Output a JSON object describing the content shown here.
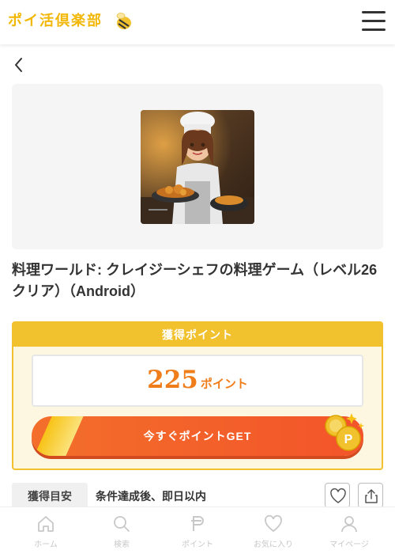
{
  "header": {
    "logo_text": "ポイ活倶楽部",
    "logo_icon": "bee-icon",
    "menu_icon": "hamburger-menu-icon"
  },
  "nav": {
    "back_icon": "chevron-left-icon"
  },
  "offer": {
    "image_alt": "料理ワールド アプリアイコン",
    "title": "料理ワールド: クレイジーシェフの料理ゲーム（レベル26クリア）（Android）"
  },
  "points": {
    "header": "獲得ポイント",
    "amount": "225",
    "unit": "ポイント",
    "button_label": "今すぐポイントGET",
    "coins_icon": "point-coins-icon"
  },
  "meta": {
    "key": "獲得目安",
    "value": "条件達成後、即日以内",
    "favorite_icon": "heart-icon",
    "share_icon": "share-icon"
  },
  "bottom_nav": {
    "items": [
      {
        "label": "ホーム",
        "icon": "home-icon"
      },
      {
        "label": "検索",
        "icon": "search-icon"
      },
      {
        "label": "ポイント",
        "icon": "point-icon"
      },
      {
        "label": "お気に入り",
        "icon": "heart-icon"
      },
      {
        "label": "マイページ",
        "icon": "user-icon"
      }
    ]
  },
  "colors": {
    "accent_yellow": "#f2c12e",
    "points_orange": "#ef7d1a",
    "button_orange": "#f3542a",
    "nav_inactive": "#c8c8c8"
  }
}
